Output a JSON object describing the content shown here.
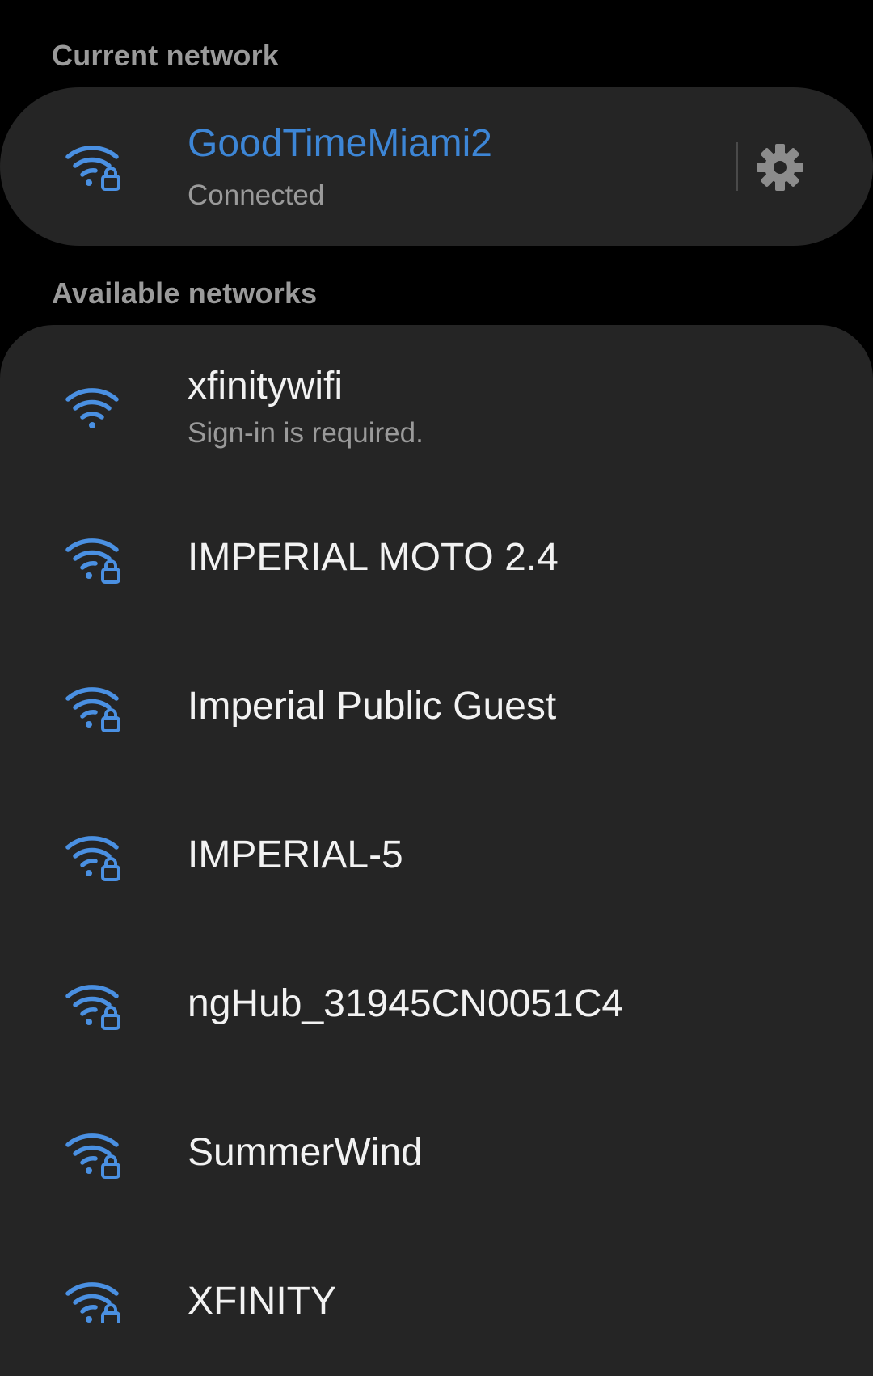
{
  "sections": {
    "current_header": "Current network",
    "available_header": "Available networks"
  },
  "current_network": {
    "name": "GoodTimeMiami2",
    "status": "Connected",
    "icon": "wifi-lock-icon",
    "settings_icon": "gear-icon"
  },
  "available_networks": [
    {
      "name": "xfinitywifi",
      "subtitle": "Sign-in is required.",
      "icon": "wifi-icon",
      "secured": false
    },
    {
      "name": "IMPERIAL MOTO 2.4",
      "icon": "wifi-lock-icon",
      "secured": true
    },
    {
      "name": "Imperial Public Guest",
      "icon": "wifi-lock-icon",
      "secured": true
    },
    {
      "name": "IMPERIAL-5",
      "icon": "wifi-lock-icon",
      "secured": true
    },
    {
      "name": "ngHub_31945CN0051C4",
      "icon": "wifi-lock-icon",
      "secured": true
    },
    {
      "name": "SummerWind",
      "icon": "wifi-lock-icon",
      "secured": true
    },
    {
      "name": "XFINITY",
      "icon": "wifi-lock-icon",
      "secured": true
    }
  ],
  "colors": {
    "accent": "#3d86d6",
    "icon": "#4a90e2",
    "card": "#252525",
    "background": "#000000",
    "secondary_text": "#9a9a9a"
  }
}
